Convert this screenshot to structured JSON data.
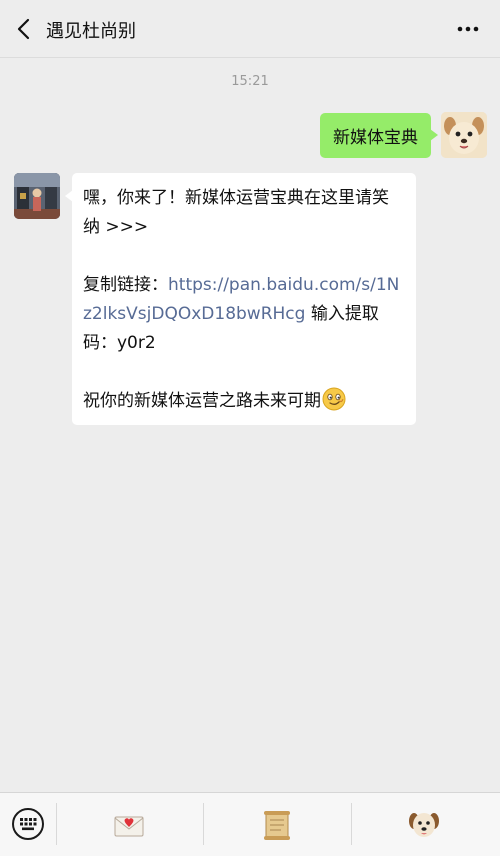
{
  "header": {
    "title": "遇见杜尚别",
    "back_icon": "chevron-left-icon",
    "more_icon": "more-dots-icon"
  },
  "chat": {
    "timestamp": "15:21",
    "sent_message": "新媒体宝典",
    "reply": {
      "line1": "嘿，你来了！新媒体运营宝典在这里请笑纳 >>>",
      "copy_label": "复制链接：",
      "link": "https://pan.baidu.com/s/1Nz2lksVsjDQOxD18bwRHcg",
      "after_link": " 输入提取码：",
      "code": "y0r2",
      "closing": "祝你的新媒体运营之路未来可期"
    }
  },
  "toolbar": {
    "keyboard_icon": "keyboard-icon",
    "tools": [
      "mail-heart-icon",
      "scroll-icon",
      "puppy-icon"
    ]
  },
  "colors": {
    "background": "#ededed",
    "sent_bubble": "#95ec69",
    "received_bubble": "#ffffff",
    "link": "#576b95"
  }
}
